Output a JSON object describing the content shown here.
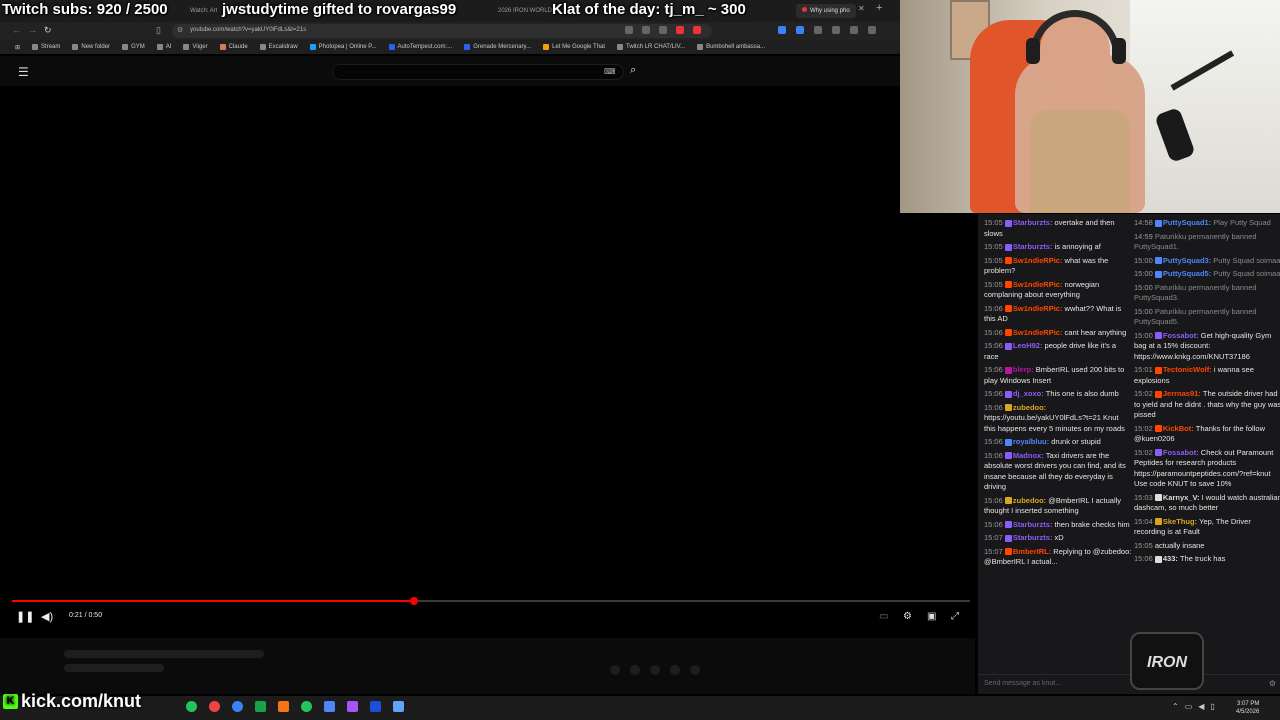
{
  "overlay": {
    "subs": "Twitch subs: 920 / 2500",
    "gift": "jwstudytime gifted to rovargas99",
    "klat": "Klat of the day: tj_m_ ~ 300"
  },
  "browser": {
    "tabs": [
      "Watch: Art",
      "2026 IRON WORLD",
      "Why using pho"
    ],
    "url": "youtube.com/watch?v=yakUY0lFdLs&t=21s",
    "bookmarks": [
      "Stream",
      "New folder",
      "GYM",
      "AI",
      "Viiger",
      "Claude",
      "Excalidraw",
      "Photopea | Online P...",
      "AutoTempest.com:...",
      "Grenade Mercenary...",
      "Let Me Google That",
      "Twitch LR CHAT/LIV...",
      "Bumbshell ambassa..."
    ]
  },
  "player": {
    "time": "0:21 / 0:50",
    "progress": 0.42
  },
  "chat": {
    "left": [
      {
        "ts": "15:05",
        "user": "Starburzts",
        "color": "#8b5cf6",
        "text": "overtake and then slows"
      },
      {
        "ts": "15:05",
        "user": "Starburzts",
        "color": "#8b5cf6",
        "text": "is annoying af"
      },
      {
        "ts": "15:05",
        "user": "Sw1ndleRPic",
        "color": "#ff4500",
        "text": "what was the problem?"
      },
      {
        "ts": "15:05",
        "user": "Sw1ndleRPic",
        "color": "#ff4500",
        "text": "norwegian complaning about everything"
      },
      {
        "ts": "15:06",
        "user": "Sw1ndleRPic",
        "color": "#ff4500",
        "text": "wwhat?? What is this AD"
      },
      {
        "ts": "15:06",
        "user": "Sw1ndleRPic",
        "color": "#ff4500",
        "text": "cant hear anything"
      },
      {
        "ts": "15:06",
        "user": "LeoH92",
        "color": "#8b5cf6",
        "text": "people drive like it's a race"
      },
      {
        "ts": "15:06",
        "user": "blerp",
        "color": "#b5179e",
        "text": "BmberIRL used 200 bits to play Windows Insert"
      },
      {
        "ts": "15:06",
        "user": "dj_xoxo",
        "color": "#8b5cf6",
        "text": "This one is also dumb"
      },
      {
        "ts": "15:06",
        "user": "zubedoo",
        "color": "#daa520",
        "text": "https://youtu.be/yakUY0lFdLs?t=21 Knut this happens every 5 minutes on my roads"
      },
      {
        "ts": "15:06",
        "user": "royalbluu",
        "color": "#4f86f7",
        "text": "drunk or stupid"
      },
      {
        "ts": "15:06",
        "user": "Madnox",
        "color": "#8b5cf6",
        "text": "Taxi drivers are the absolute worst drivers you can find, and its insane because all they do everyday is driving"
      },
      {
        "ts": "15:06",
        "user": "zubedoo",
        "color": "#daa520",
        "text": "@BmberIRL I actually thought I inserted something"
      },
      {
        "ts": "15:06",
        "user": "Starburzts",
        "color": "#8b5cf6",
        "text": "then brake checks him"
      },
      {
        "ts": "15:07",
        "user": "Starburzts",
        "color": "#8b5cf6",
        "text": "xD"
      },
      {
        "ts": "15:07",
        "user": "BmberIRL",
        "color": "#ff4500",
        "text": "Replying to @zubedoo: @BmberIRL I actual..."
      }
    ],
    "right": [
      {
        "ts": "14:58",
        "user": "PuttySquad1",
        "color": "#4f86f7",
        "text": "Play Putty Squad",
        "dim": true
      },
      {
        "ts": "14:59",
        "user": "",
        "color": "#888",
        "text": "Paturikku permanently banned PuttySquad1.",
        "dim": true
      },
      {
        "ts": "15:00",
        "user": "PuttySquad3",
        "color": "#4f86f7",
        "text": "Putty Squad soimaa",
        "dim": true
      },
      {
        "ts": "15:00",
        "user": "PuttySquad5",
        "color": "#4f86f7",
        "text": "Putty Squad soimaa",
        "dim": true
      },
      {
        "ts": "15:00",
        "user": "",
        "color": "#888",
        "text": "Paturikku permanently banned PuttySquad3.",
        "dim": true
      },
      {
        "ts": "15:00",
        "user": "",
        "color": "#888",
        "text": "Paturikku permanently banned PuttySquad5.",
        "dim": true
      },
      {
        "ts": "15:00",
        "user": "Fossabot",
        "color": "#8b5cf6",
        "text": "Get high-quality Gym bag at a 15% discount: https://www.knkg.com/KNUT37186"
      },
      {
        "ts": "15:01",
        "user": "TectonicWolf",
        "color": "#ff4500",
        "text": "i wanna see explosions"
      },
      {
        "ts": "15:02",
        "user": "Jerrnas91",
        "color": "#ff4500",
        "text": "The outside driver had to yield and he didnt . thats why the guy was pissed"
      },
      {
        "ts": "15:02",
        "user": "KickBot",
        "color": "#ff4500",
        "text": "Thanks for the follow @kuen0206"
      },
      {
        "ts": "15:02",
        "user": "Fossabot",
        "color": "#8b5cf6",
        "text": "Check out Paramount Peptides for research products https://paramountpeptides.com/?ref=knut Use code KNUT to save 10%"
      },
      {
        "ts": "15:03",
        "user": "Karnyx_V",
        "color": "#ddd",
        "text": "I would watch australian dashcam, so much better"
      },
      {
        "ts": "15:04",
        "user": "SkeThug",
        "color": "#daa520",
        "text": "Yep, The Driver recording is at Fault"
      },
      {
        "ts": "15:05",
        "user": "",
        "color": "#ddd",
        "text": "actually insane"
      },
      {
        "ts": "15:06",
        "user": "433",
        "color": "#ddd",
        "text": "The truck has"
      }
    ],
    "input_placeholder": "Send message as knut..."
  },
  "taskbar": {
    "kick": "kick.com/knut",
    "time": "3:07 PM",
    "date": "4/5/2026"
  },
  "logo": "IRON"
}
